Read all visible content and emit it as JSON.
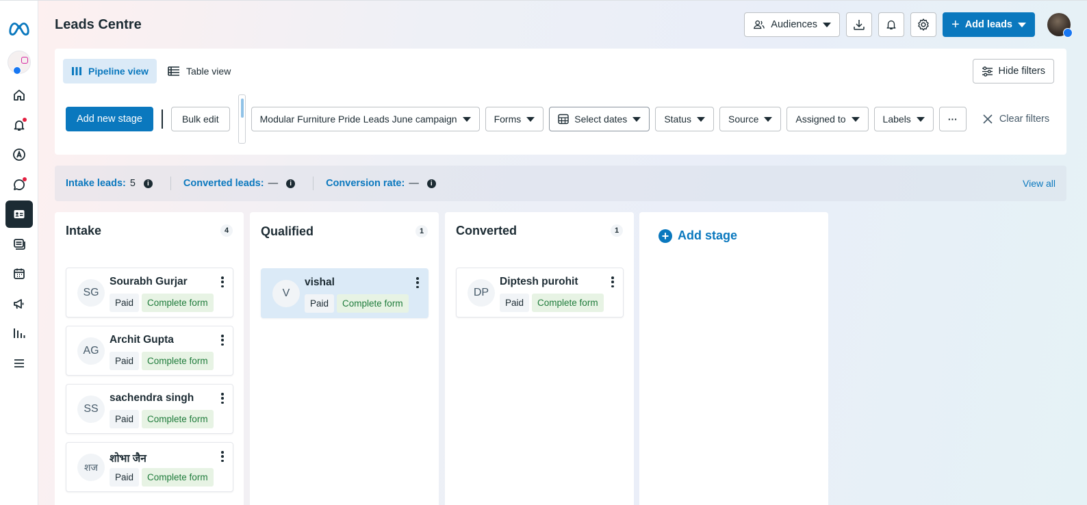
{
  "sidebar": {
    "logo": "meta-logo-icon",
    "items": [
      {
        "name": "home-icon"
      },
      {
        "name": "notifications-icon",
        "dot": true
      },
      {
        "name": "ads-manager-icon"
      },
      {
        "name": "messages-icon",
        "dot": true
      },
      {
        "name": "leads-centre-icon",
        "active": true
      },
      {
        "name": "content-icon"
      },
      {
        "name": "planner-icon"
      },
      {
        "name": "campaigns-icon"
      },
      {
        "name": "insights-icon"
      },
      {
        "name": "menu-icon"
      }
    ]
  },
  "header": {
    "title": "Leads Centre",
    "audiences_label": "Audiences",
    "add_leads_label": "Add leads"
  },
  "views": {
    "pipeline": "Pipeline view",
    "table": "Table view"
  },
  "filters": {
    "hide_filters": "Hide filters",
    "add_new_stage": "Add new stage",
    "bulk_edit": "Bulk edit",
    "campaign": "Modular Furniture Pride Leads June campaign",
    "forms": "Forms",
    "select_dates": "Select dates",
    "status": "Status",
    "source": "Source",
    "assigned_to": "Assigned to",
    "labels": "Labels",
    "more": "···",
    "clear_filters": "Clear filters"
  },
  "stats": {
    "intake_label": "Intake leads:",
    "intake_value": "5",
    "converted_label": "Converted leads:",
    "converted_value": "—",
    "rate_label": "Conversion rate:",
    "rate_value": "—",
    "view_all": "View all"
  },
  "columns": [
    {
      "title": "Intake",
      "count": "4",
      "cards": [
        {
          "initials": "SG",
          "name": "Sourabh Gurjar",
          "tag1": "Paid",
          "tag2": "Complete form"
        },
        {
          "initials": "AG",
          "name": "Archit Gupta",
          "tag1": "Paid",
          "tag2": "Complete form"
        },
        {
          "initials": "SS",
          "name": "sachendra singh",
          "tag1": "Paid",
          "tag2": "Complete form"
        },
        {
          "initials": "शज",
          "name": "शोभा जैन",
          "tag1": "Paid",
          "tag2": "Complete form"
        }
      ]
    },
    {
      "title": "Qualified",
      "count": "1",
      "cards": [
        {
          "initials": "V",
          "name": "vishal",
          "tag1": "Paid",
          "tag2": "Complete form"
        }
      ]
    },
    {
      "title": "Converted",
      "count": "1",
      "cards": [
        {
          "initials": "DP",
          "name": "Diptesh purohit",
          "tag1": "Paid",
          "tag2": "Complete form"
        }
      ]
    }
  ],
  "add_stage": "Add stage",
  "colors": {
    "primary": "#0a78be",
    "text": "#1c2b33",
    "highlight": "#dbeaf7",
    "complete_bg": "#e7f3e4",
    "complete_text": "#1e7b3a",
    "notification_dot": "#e41e3f"
  }
}
